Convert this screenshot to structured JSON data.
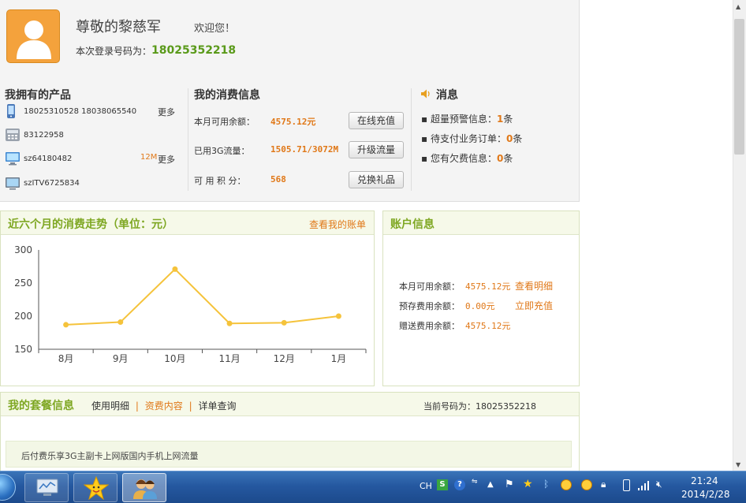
{
  "header": {
    "greeting_name": "尊敬的黎慈军",
    "welcome": "欢迎您！",
    "login_label": "本次登录号码为：",
    "login_number": "18025352218"
  },
  "products": {
    "title": "我拥有的产品",
    "items": [
      {
        "icon": "mobile-phone-icon",
        "text": "18025310528 18038065540",
        "badge": "",
        "more": "更多"
      },
      {
        "icon": "landline-phone-icon",
        "text": "83122958",
        "badge": "",
        "more": ""
      },
      {
        "icon": "computer-icon",
        "text": "sz64180482",
        "badge": "12M",
        "more": "更多"
      },
      {
        "icon": "tv-icon",
        "text": "szITV6725834",
        "badge": "",
        "more": ""
      }
    ]
  },
  "consumption": {
    "title": "我的消费信息",
    "rows": [
      {
        "label": "本月可用余额：",
        "value": "4575.12元",
        "button": "在线充值"
      },
      {
        "label": "已用3G流量：",
        "value": "1505.71/3072M",
        "button": "升级流量"
      },
      {
        "label": "可 用 积 分：",
        "value": "568",
        "button": "兑换礼品"
      }
    ]
  },
  "messages": {
    "title": "消息",
    "icon": "speaker-icon",
    "items": [
      {
        "label": "超量预警信息：",
        "count": "1",
        "unit": "条"
      },
      {
        "label": "待支付业务订单：",
        "count": "0",
        "unit": "条"
      },
      {
        "label": "您有欠费信息：",
        "count": "0",
        "unit": "条"
      }
    ]
  },
  "trend": {
    "title": "近六个月的消费走势（单位：元）",
    "link": "查看我的账单"
  },
  "chart_data": {
    "type": "line",
    "title": "近六个月的消费走势（单位：元）",
    "categories": [
      "8月",
      "9月",
      "10月",
      "11月",
      "12月",
      "1月"
    ],
    "values": [
      187,
      191,
      271,
      189,
      190,
      200
    ],
    "ylim": [
      150,
      300
    ],
    "yticks": [
      "300",
      "250",
      "200",
      "150"
    ],
    "grid": false,
    "color": "#f5c33b"
  },
  "account": {
    "title": "账户信息",
    "rows": [
      {
        "label": "本月可用余额：",
        "value": "4575.12元",
        "link": "查看明细"
      },
      {
        "label": "预存费用余额：",
        "value": "0.00元",
        "link": "立即充值"
      },
      {
        "label": "赠送费用余额：",
        "value": "4575.12元",
        "link": ""
      }
    ]
  },
  "package": {
    "title": "我的套餐信息",
    "tabs": [
      "使用明细",
      "资费内容",
      "详单查询"
    ],
    "separator": "|",
    "current_label": "当前号码为：",
    "current_number": "18025352218",
    "plan_text": "后付费乐享3G主副卡上网版国内手机上网流量"
  },
  "taskbar": {
    "tray": {
      "ime": "CH"
    },
    "time": "21:24",
    "date": "2014/2/28"
  },
  "colors": {
    "accent_green": "#7ea722",
    "accent_orange": "#e07818",
    "chart_line": "#f5c33b",
    "taskbar": "#2558a0"
  }
}
